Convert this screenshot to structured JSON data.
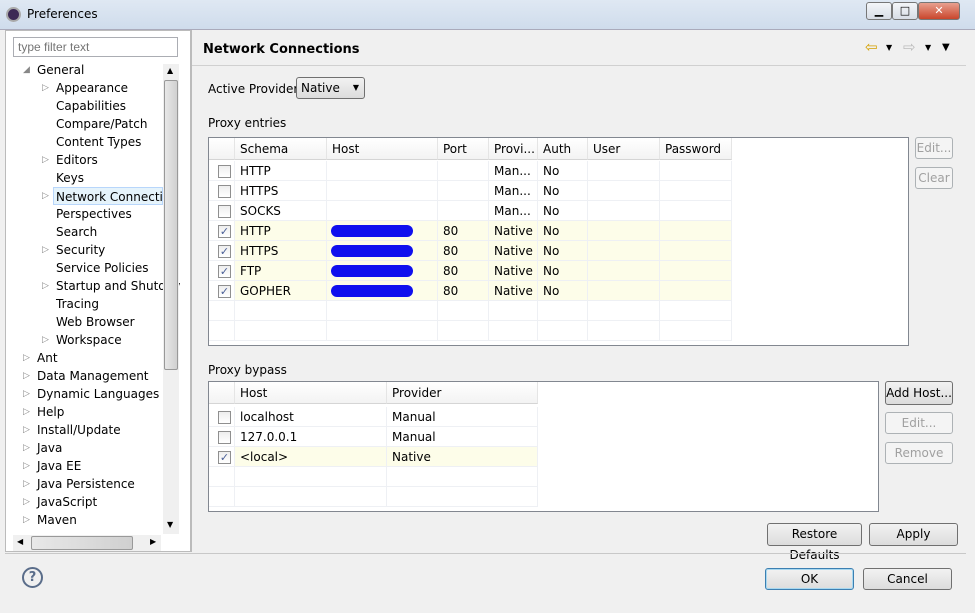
{
  "window": {
    "title": "Preferences",
    "minimize": "▁",
    "maximize": "□",
    "close": "✕"
  },
  "sidebar": {
    "filter_placeholder": "type filter text",
    "items": [
      {
        "label": "General",
        "level": 0,
        "expanded": true
      },
      {
        "label": "Appearance",
        "level": 1,
        "arrow": true
      },
      {
        "label": "Capabilities",
        "level": 1
      },
      {
        "label": "Compare/Patch",
        "level": 1
      },
      {
        "label": "Content Types",
        "level": 1
      },
      {
        "label": "Editors",
        "level": 1,
        "arrow": true
      },
      {
        "label": "Keys",
        "level": 1
      },
      {
        "label": "Network Connection",
        "level": 1,
        "arrow": true,
        "selected": true
      },
      {
        "label": "Perspectives",
        "level": 1
      },
      {
        "label": "Search",
        "level": 1
      },
      {
        "label": "Security",
        "level": 1,
        "arrow": true
      },
      {
        "label": "Service Policies",
        "level": 1
      },
      {
        "label": "Startup and Shutdov",
        "level": 1,
        "arrow": true
      },
      {
        "label": "Tracing",
        "level": 1
      },
      {
        "label": "Web Browser",
        "level": 1
      },
      {
        "label": "Workspace",
        "level": 1,
        "arrow": true
      },
      {
        "label": "Ant",
        "level": 0
      },
      {
        "label": "Data Management",
        "level": 0
      },
      {
        "label": "Dynamic Languages",
        "level": 0
      },
      {
        "label": "Help",
        "level": 0
      },
      {
        "label": "Install/Update",
        "level": 0
      },
      {
        "label": "Java",
        "level": 0
      },
      {
        "label": "Java EE",
        "level": 0
      },
      {
        "label": "Java Persistence",
        "level": 0
      },
      {
        "label": "JavaScript",
        "level": 0
      },
      {
        "label": "Maven",
        "level": 0
      }
    ]
  },
  "page": {
    "title": "Network Connections",
    "active_provider_label": "Active Provider:",
    "active_provider_value": "Native",
    "proxy_entries_label": "Proxy entries",
    "proxy_columns": [
      "Schema",
      "Host",
      "Port",
      "Provi...",
      "Auth",
      "User",
      "Password"
    ],
    "proxy_rows": [
      {
        "checked": false,
        "schema": "HTTP",
        "host": "",
        "port": "",
        "provider": "Man...",
        "auth": "No",
        "user": "",
        "password": ""
      },
      {
        "checked": false,
        "schema": "HTTPS",
        "host": "",
        "port": "",
        "provider": "Man...",
        "auth": "No",
        "user": "",
        "password": ""
      },
      {
        "checked": false,
        "schema": "SOCKS",
        "host": "",
        "port": "",
        "provider": "Man...",
        "auth": "No",
        "user": "",
        "password": ""
      },
      {
        "checked": true,
        "schema": "HTTP",
        "host": "[redacted]",
        "port": "80",
        "provider": "Native",
        "auth": "No",
        "user": "",
        "password": ""
      },
      {
        "checked": true,
        "schema": "HTTPS",
        "host": "[redacted]",
        "port": "80",
        "provider": "Native",
        "auth": "No",
        "user": "",
        "password": ""
      },
      {
        "checked": true,
        "schema": "FTP",
        "host": "[redacted]",
        "port": "80",
        "provider": "Native",
        "auth": "No",
        "user": "",
        "password": ""
      },
      {
        "checked": true,
        "schema": "GOPHER",
        "host": "[redacted]",
        "port": "80",
        "provider": "Native",
        "auth": "No",
        "user": "",
        "password": ""
      }
    ],
    "proxy_buttons": {
      "edit": "Edit...",
      "clear": "Clear"
    },
    "bypass_label": "Proxy bypass",
    "bypass_columns": [
      "Host",
      "Provider"
    ],
    "bypass_rows": [
      {
        "checked": false,
        "host": "localhost",
        "provider": "Manual"
      },
      {
        "checked": false,
        "host": "127.0.0.1",
        "provider": "Manual"
      },
      {
        "checked": true,
        "host": "<local>",
        "provider": "Native"
      }
    ],
    "bypass_buttons": {
      "add": "Add Host...",
      "edit": "Edit...",
      "remove": "Remove"
    },
    "restore_defaults": "Restore Defaults",
    "apply": "Apply"
  },
  "footer": {
    "ok": "OK",
    "cancel": "Cancel",
    "help": "?"
  },
  "colors": {
    "highlight_row": "#fdfde9",
    "redaction": "#1010ee",
    "selection": "#cce8ff"
  }
}
